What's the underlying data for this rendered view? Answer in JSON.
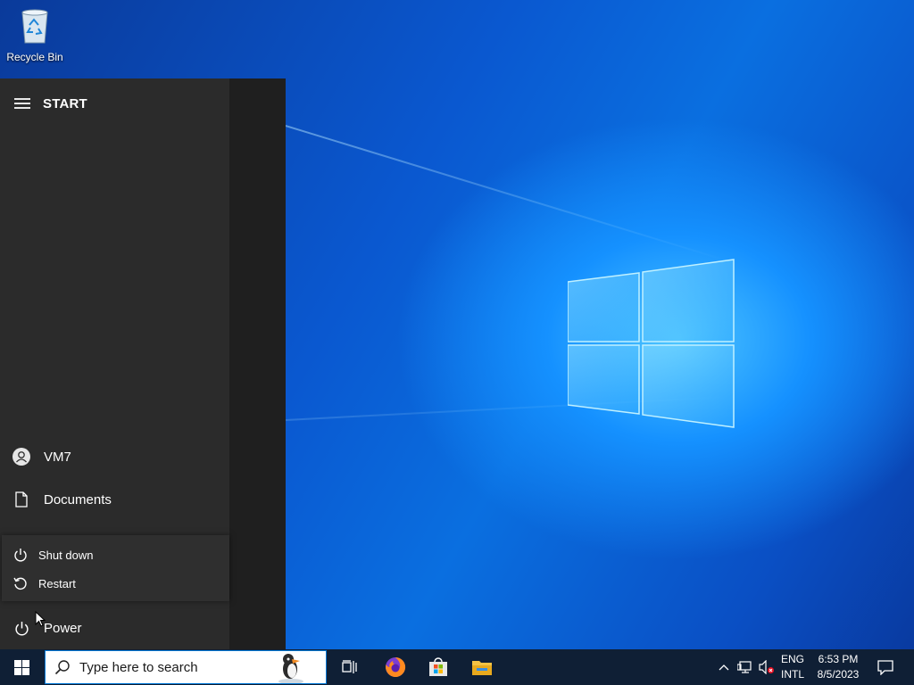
{
  "desktop": {
    "icons": [
      {
        "label": "Recycle Bin",
        "icon": "recycle-bin-icon"
      }
    ]
  },
  "start_menu": {
    "title": "START",
    "menu_icon": "hamburger-icon",
    "user": {
      "label": "VM7",
      "icon": "user-avatar-icon"
    },
    "documents": {
      "label": "Documents",
      "icon": "document-icon"
    },
    "power_menu": {
      "shut_down": {
        "label": "Shut down",
        "icon": "power-icon"
      },
      "restart": {
        "label": "Restart",
        "icon": "restart-icon"
      }
    },
    "power": {
      "label": "Power",
      "icon": "power-icon"
    }
  },
  "taskbar": {
    "start_icon": "windows-icon",
    "search": {
      "placeholder": "Type here to search",
      "icon": "search-icon"
    },
    "pinned": [
      {
        "name": "Task View",
        "icon": "task-view-icon"
      },
      {
        "name": "Firefox",
        "icon": "firefox-icon"
      },
      {
        "name": "Microsoft Store",
        "icon": "store-icon"
      },
      {
        "name": "File Explorer",
        "icon": "folder-icon"
      }
    ],
    "tray": {
      "lang_line1": "ENG",
      "lang_line2": "INTL",
      "time": "6:53 PM",
      "date": "8/5/2023"
    }
  }
}
